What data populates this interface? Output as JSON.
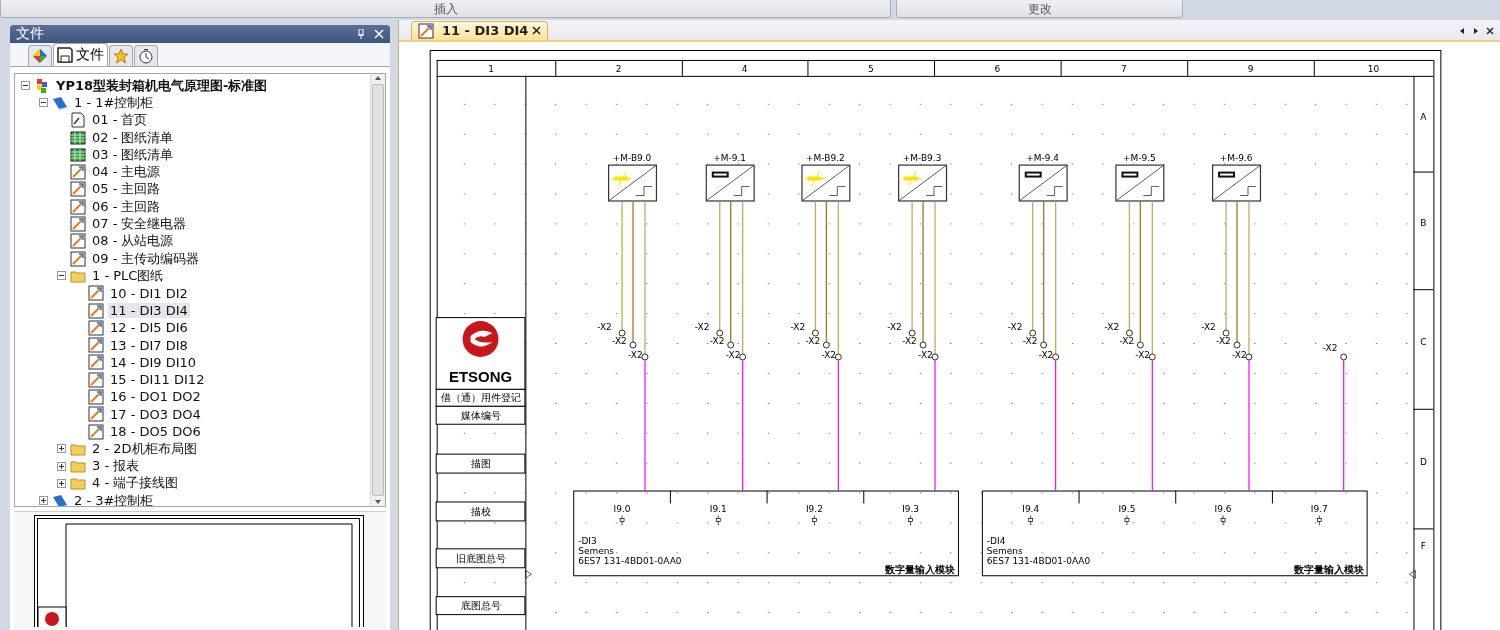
{
  "top_buttons": [
    {
      "label": "插入"
    },
    {
      "label": "更改"
    }
  ],
  "file_panel": {
    "title": "文件",
    "tabs": [
      {
        "kind": "palette",
        "selected": false
      },
      {
        "kind": "save",
        "label": "文件",
        "selected": true
      },
      {
        "kind": "star",
        "selected": false
      },
      {
        "kind": "clock",
        "selected": false
      }
    ],
    "tree": [
      {
        "label": "YP18型装封箱机电气原理图-标准图",
        "kind": "project",
        "selected": false,
        "expanded": true,
        "children": [
          {
            "label": "1 - 1#控制柜",
            "kind": "cabinet",
            "selected": false,
            "expanded": true,
            "children": [
              {
                "label": "01 - 首页",
                "kind": "cover",
                "selected": false
              },
              {
                "label": "02 - 图纸清单",
                "kind": "table",
                "selected": false
              },
              {
                "label": "03 - 图纸清单",
                "kind": "table",
                "selected": false
              },
              {
                "label": "04 - 主电源",
                "kind": "schematic",
                "selected": false
              },
              {
                "label": "05 - 主回路",
                "kind": "schematic",
                "selected": false
              },
              {
                "label": "06 - 主回路",
                "kind": "schematic",
                "selected": false
              },
              {
                "label": "07 - 安全继电器",
                "kind": "schematic",
                "selected": false
              },
              {
                "label": "08 - 从站电源",
                "kind": "schematic",
                "selected": false
              },
              {
                "label": "09 - 主传动编码器",
                "kind": "schematic",
                "selected": false
              },
              {
                "label": "1 - PLC图纸",
                "kind": "folder",
                "selected": false,
                "expanded": true,
                "children": [
                  {
                    "label": "10 - DI1 DI2",
                    "kind": "schematic",
                    "selected": false
                  },
                  {
                    "label": "11 - DI3 DI4",
                    "kind": "schematic",
                    "selected": true
                  },
                  {
                    "label": "12 - DI5 DI6",
                    "kind": "schematic",
                    "selected": false
                  },
                  {
                    "label": "13 - DI7 DI8",
                    "kind": "schematic",
                    "selected": false
                  },
                  {
                    "label": "14 - DI9 DI10",
                    "kind": "schematic",
                    "selected": false
                  },
                  {
                    "label": "15 - DI11 DI12",
                    "kind": "schematic",
                    "selected": false
                  },
                  {
                    "label": "16 - DO1 DO2",
                    "kind": "schematic",
                    "selected": false
                  },
                  {
                    "label": "17 - DO3 DO4",
                    "kind": "schematic",
                    "selected": false
                  },
                  {
                    "label": "18 - DO5 DO6",
                    "kind": "schematic",
                    "selected": false
                  }
                ]
              },
              {
                "label": "2 - 2D机柜布局图",
                "kind": "folder",
                "selected": false,
                "expanded": false
              },
              {
                "label": "3 - 报表",
                "kind": "folder",
                "selected": false,
                "expanded": false
              },
              {
                "label": "4 - 端子接线图",
                "kind": "folder",
                "selected": false,
                "expanded": false
              }
            ]
          },
          {
            "label": "2 - 3#控制柜",
            "kind": "cabinet",
            "selected": false,
            "expanded": false
          }
        ]
      }
    ]
  },
  "document": {
    "tabs": [
      {
        "label": "11 - DI3 DI4",
        "selected": true
      }
    ],
    "sheet": {
      "columns": [
        "1",
        "2",
        "4",
        "5",
        "6",
        "7",
        "9",
        "10"
      ],
      "rows": [
        "A",
        "B",
        "C",
        "D",
        "F"
      ],
      "logo": "ETSONG",
      "title_block": [
        "借（通）用件登记",
        "媒体编号",
        "描图",
        "描校",
        "旧底图总号",
        "底图总号"
      ],
      "sensors": [
        {
          "tag": "+M-B9.0",
          "kind": "lamp",
          "terminals": [
            "-X2",
            "-X2",
            "-X2"
          ]
        },
        {
          "tag": "+M-9.1",
          "kind": "box",
          "terminals": [
            "-X2",
            "-X2",
            "-X2"
          ]
        },
        {
          "tag": "+M-B9.2",
          "kind": "lamp",
          "terminals": [
            "-X2",
            "-X2",
            "-X2"
          ]
        },
        {
          "tag": "+M-B9.3",
          "kind": "lamp",
          "terminals": [
            "-X2",
            "-X2",
            "-X2"
          ]
        },
        {
          "tag": "+M-9.4",
          "kind": "box",
          "terminals": [
            "-X2",
            "-X2",
            "-X2"
          ]
        },
        {
          "tag": "+M-9.5",
          "kind": "box",
          "terminals": [
            "-X2",
            "-X2",
            "-X2"
          ]
        },
        {
          "tag": "+M-9.6",
          "kind": "box",
          "terminals": [
            "-X2",
            "-X2",
            "-X2"
          ]
        }
      ],
      "spare_terminal": "-X2",
      "modules": [
        {
          "tag": "-DI3",
          "maker": "Semens",
          "part": "6ES7 131-4BD01-0AA0",
          "title": "数字量输入模块",
          "channels": [
            "I9.0",
            "I9.1",
            "I9.2",
            "I9.3"
          ]
        },
        {
          "tag": "-DI4",
          "maker": "Semens",
          "part": "6ES7 131-4BD01-0AA0",
          "title": "数字量输入模块",
          "channels": [
            "I9.4",
            "I9.5",
            "I9.6",
            "I9.7"
          ]
        }
      ]
    }
  }
}
